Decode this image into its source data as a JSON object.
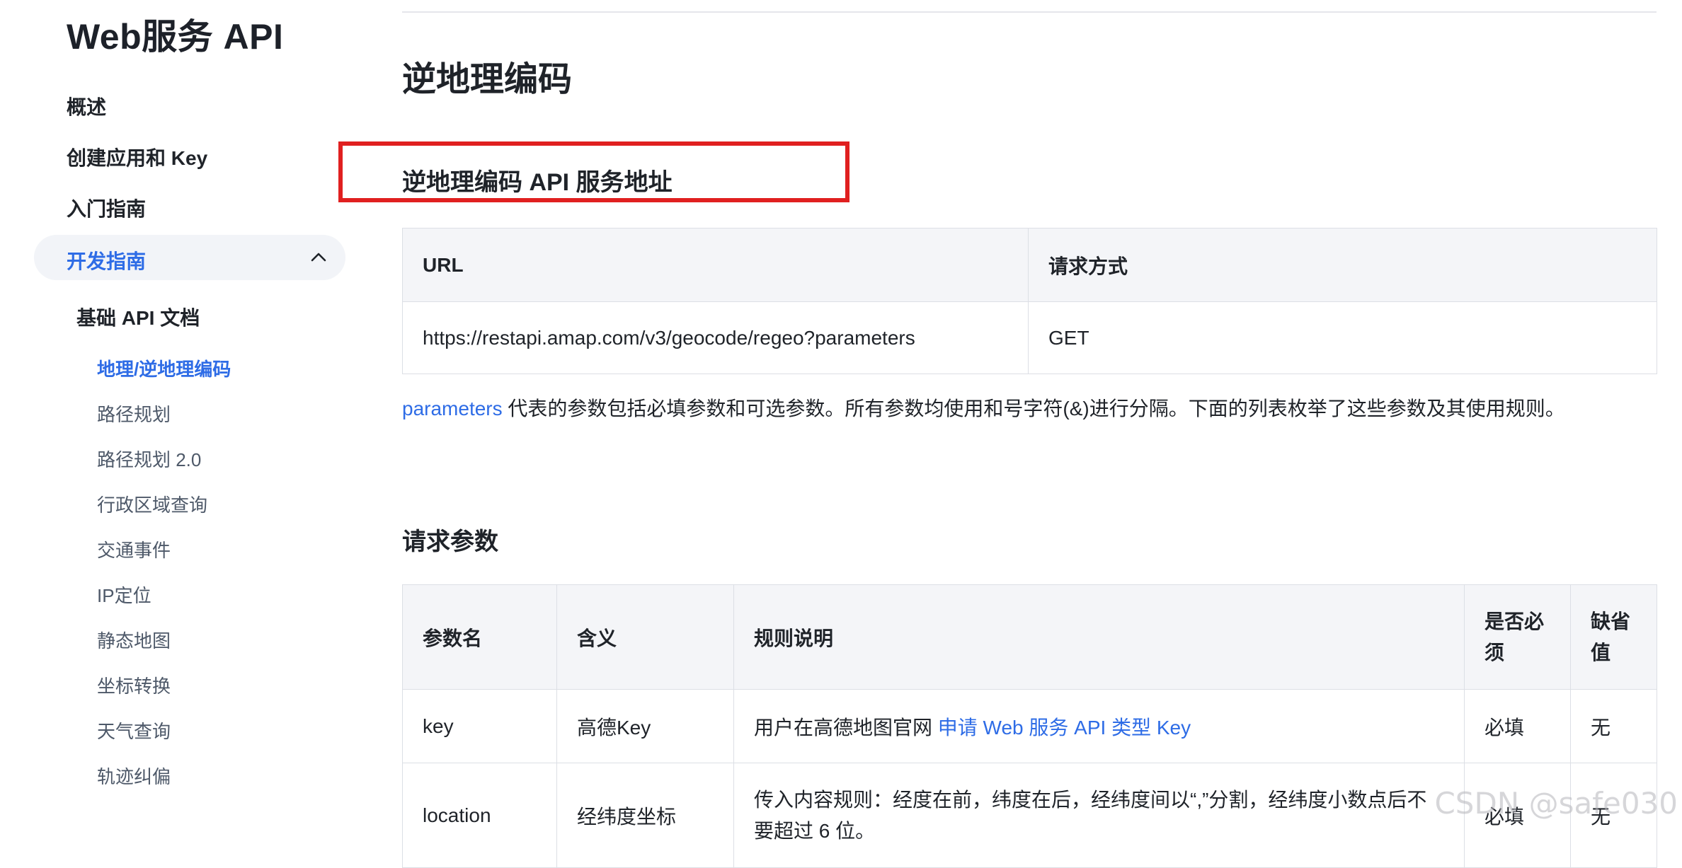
{
  "sidebar": {
    "brand": "Web服务 API",
    "items": [
      {
        "label": "概述"
      },
      {
        "label": "创建应用和 Key"
      },
      {
        "label": "入门指南"
      }
    ],
    "active_group": {
      "label": "开发指南",
      "icon": "chevron-up-icon"
    },
    "sub_group": {
      "label": "基础 API 文档"
    },
    "sub_items": [
      {
        "label": "地理/逆地理编码",
        "active": true
      },
      {
        "label": "路径规划"
      },
      {
        "label": "路径规划 2.0"
      },
      {
        "label": "行政区域查询"
      },
      {
        "label": "交通事件"
      },
      {
        "label": "IP定位"
      },
      {
        "label": "静态地图"
      },
      {
        "label": "坐标转换"
      },
      {
        "label": "天气查询"
      },
      {
        "label": "轨迹纠偏"
      }
    ]
  },
  "main": {
    "title": "逆地理编码",
    "service_address": {
      "heading": "逆地理编码 API 服务地址",
      "columns": [
        "URL",
        "请求方式"
      ],
      "rows": [
        [
          "https://restapi.amap.com/v3/geocode/regeo?parameters",
          "GET"
        ]
      ]
    },
    "description": {
      "link": "parameters",
      "text": " 代表的参数包括必填参数和可选参数。所有参数均使用和号字符(&)进行分隔。下面的列表枚举了这些参数及其使用规则。"
    },
    "request_params": {
      "heading": "请求参数",
      "columns": [
        "参数名",
        "含义",
        "规则说明",
        "是否必须",
        "缺省值"
      ],
      "rows": [
        {
          "name": "key",
          "meaning": "高德Key",
          "rule_text": "用户在高德地图官网 ",
          "rule_link": "申请 Web 服务 API 类型 Key",
          "required": "必填",
          "default": "无"
        },
        {
          "name": "location",
          "meaning": "经纬度坐标",
          "rule_text": "传入内容规则：经度在前，纬度在后，经纬度间以“,”分割，经纬度小数点后不要超过 6 位。",
          "rule_link": "",
          "required": "必填",
          "default": "无"
        }
      ]
    }
  },
  "watermark": "CSDN @safe030",
  "colors": {
    "accent": "#2e6ce6",
    "highlight_border": "#e02020",
    "table_header_bg": "#f4f5f8"
  }
}
